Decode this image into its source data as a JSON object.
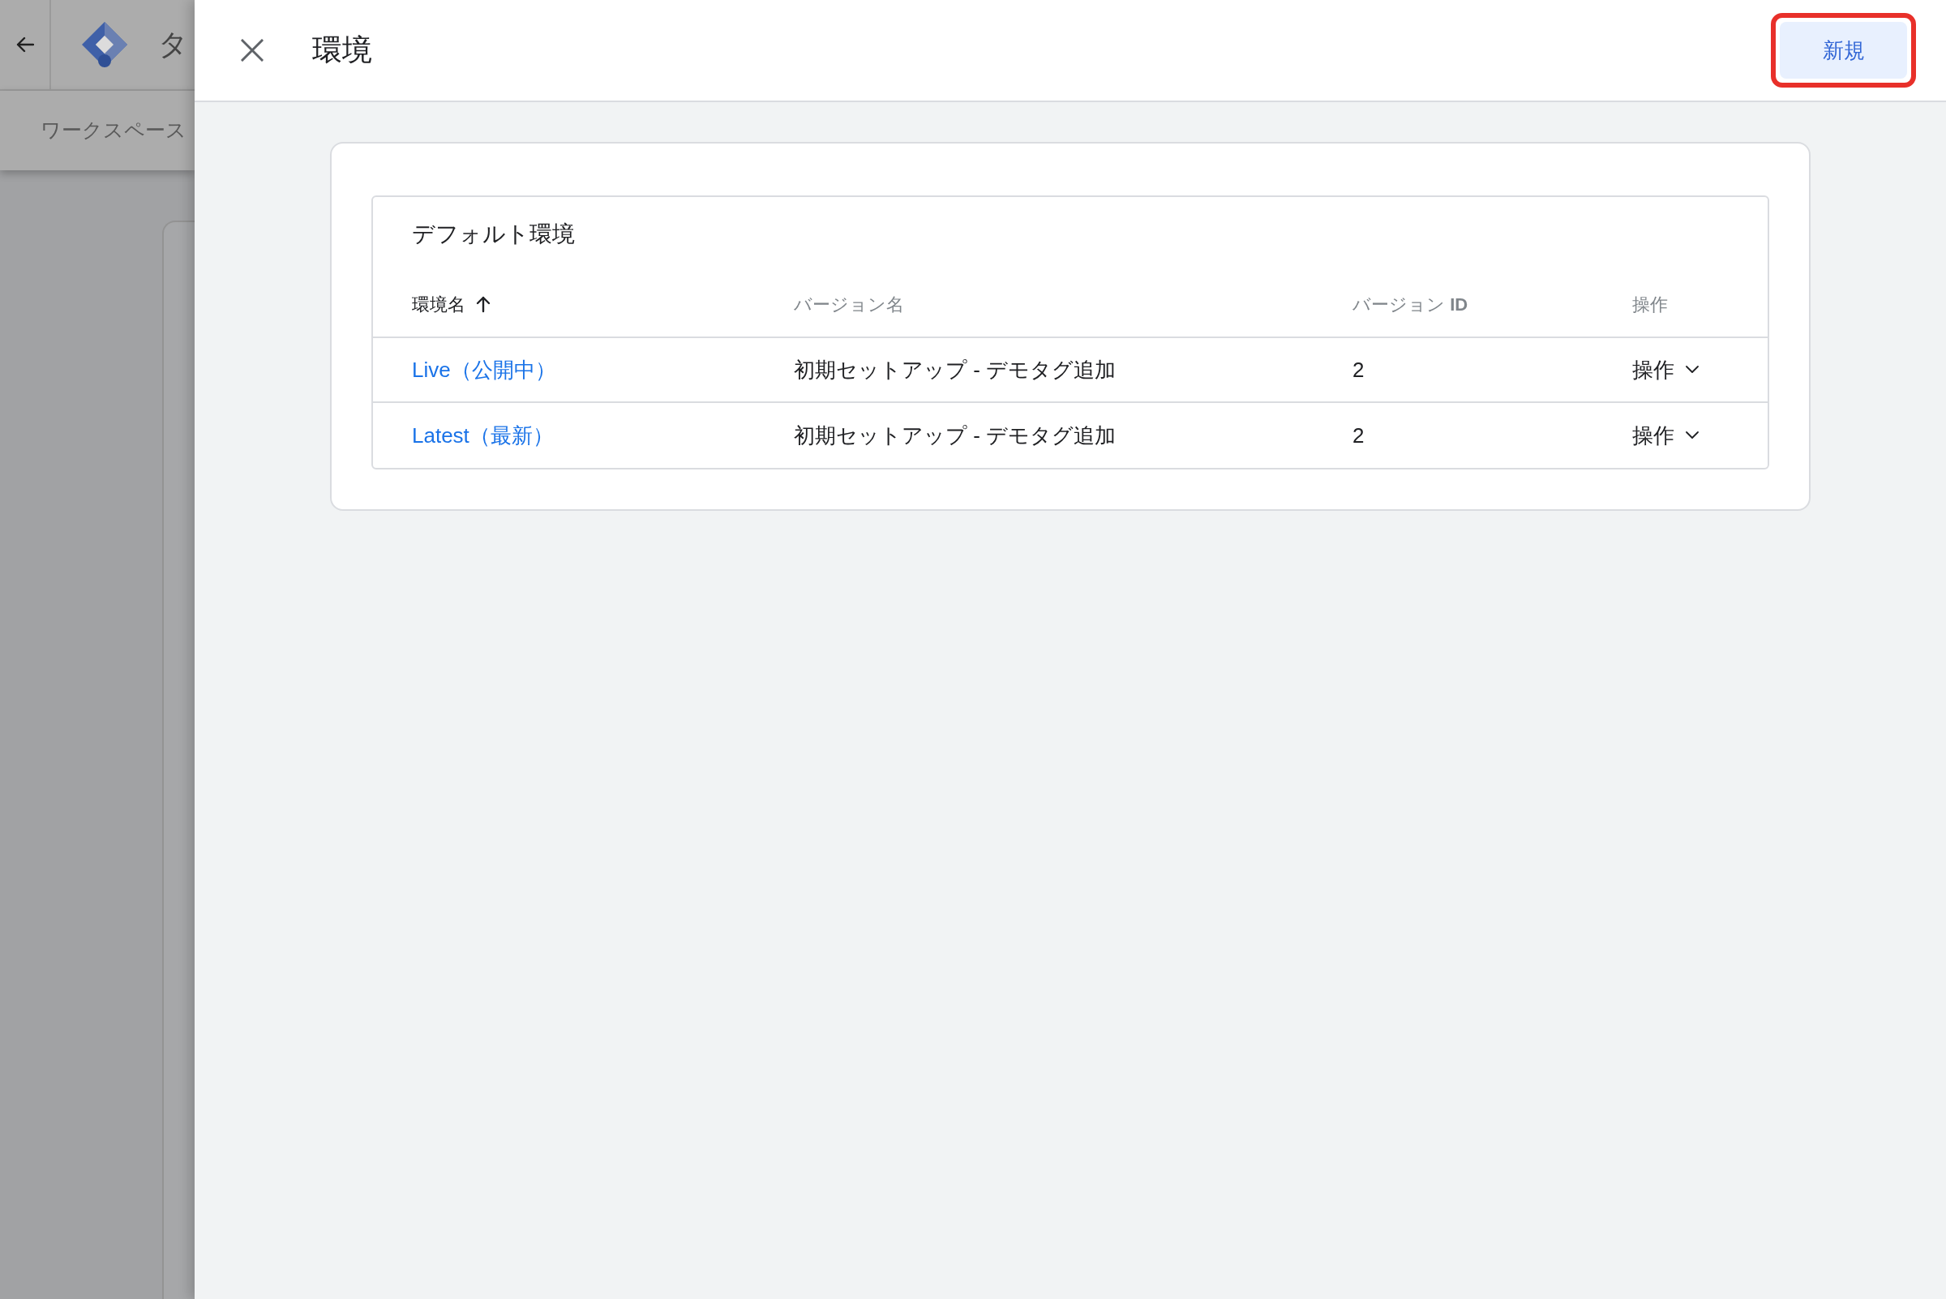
{
  "background_page": {
    "title": "タ",
    "tab": "ワークスペース"
  },
  "panel": {
    "title": "環境",
    "new_button": {
      "label": "新規",
      "highlighted": true
    }
  },
  "default_environments": {
    "title": "デフォルト環境",
    "columns": [
      {
        "label": "環境名",
        "sorted": true
      },
      {
        "label": "バージョン名",
        "sorted": false
      },
      {
        "label": "バージョン **ID**",
        "sorted": false
      },
      {
        "label": "操作",
        "sorted": false
      }
    ],
    "rows": [
      {
        "name": "Live（公開中）",
        "version_name": "初期セットアップ - デモタグ追加",
        "version_id": "2",
        "action": "操作"
      },
      {
        "name": "Latest（最新）",
        "version_name": "初期セットアップ - デモタグ追加",
        "version_id": "2",
        "action": "操作"
      }
    ]
  }
}
